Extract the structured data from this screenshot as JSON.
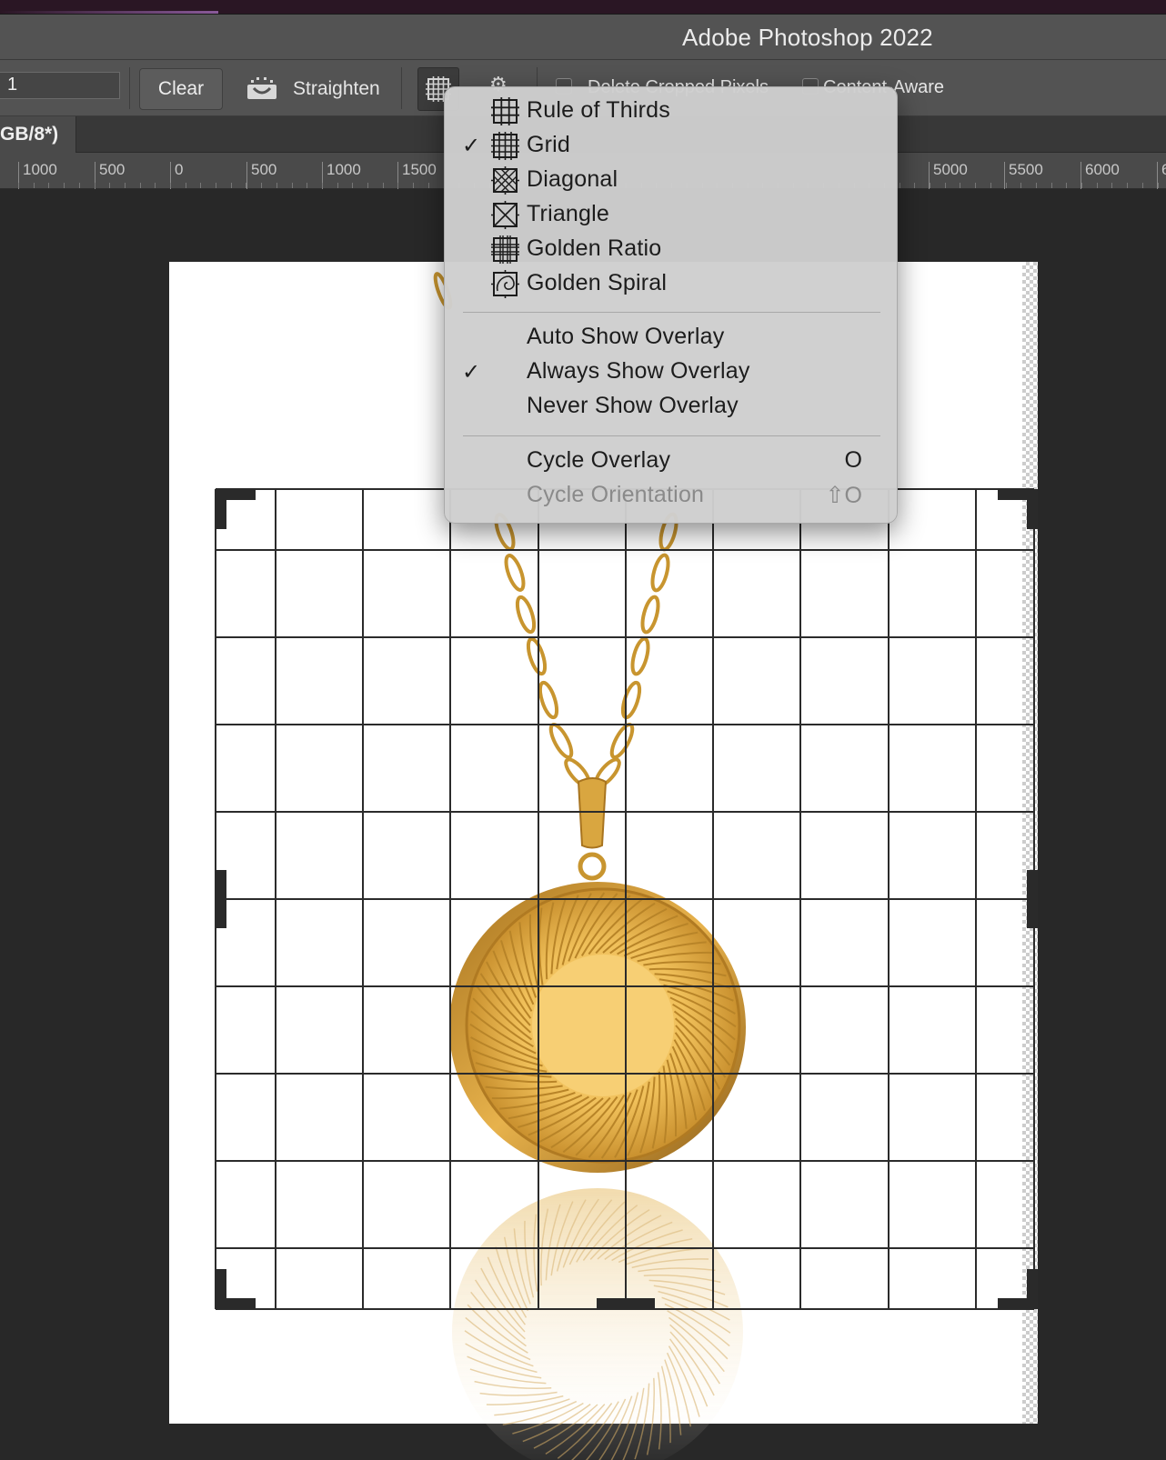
{
  "window": {
    "title": "Adobe Photoshop 2022"
  },
  "options_bar": {
    "ratio_value": "1",
    "clear_label": "Clear",
    "straighten_label": "Straighten",
    "delete_cropped_partial": "Delete Cropped Pixels",
    "content_aware_label": "Content-Aware"
  },
  "document_tab": {
    "title_fragment": "GB/8*)"
  },
  "ruler": {
    "labels": [
      "1000",
      "500",
      "0",
      "500",
      "1000",
      "1500",
      "5000",
      "5500",
      "6000",
      "6"
    ]
  },
  "overlay_menu": {
    "overlay_types": [
      {
        "label": "Rule of Thirds",
        "checked": false,
        "icon": "rule-of-thirds-icon"
      },
      {
        "label": "Grid",
        "checked": true,
        "icon": "grid-icon"
      },
      {
        "label": "Diagonal",
        "checked": false,
        "icon": "diagonal-icon"
      },
      {
        "label": "Triangle",
        "checked": false,
        "icon": "triangle-icon"
      },
      {
        "label": "Golden Ratio",
        "checked": false,
        "icon": "golden-ratio-icon"
      },
      {
        "label": "Golden Spiral",
        "checked": false,
        "icon": "golden-spiral-icon"
      }
    ],
    "show_modes": [
      {
        "label": "Auto Show Overlay",
        "checked": false
      },
      {
        "label": "Always Show Overlay",
        "checked": true
      },
      {
        "label": "Never Show Overlay",
        "checked": false
      }
    ],
    "cycle_overlay": {
      "label": "Cycle Overlay",
      "shortcut": "O",
      "enabled": true
    },
    "cycle_orientation": {
      "label": "Cycle Orientation",
      "shortcut": "⇧O",
      "enabled": false
    },
    "check_glyph": "✓"
  },
  "colors": {
    "panel": "#535353",
    "canvas_bg": "#282828",
    "menu_bg": "#cecece",
    "gold": "#e8b74a"
  }
}
